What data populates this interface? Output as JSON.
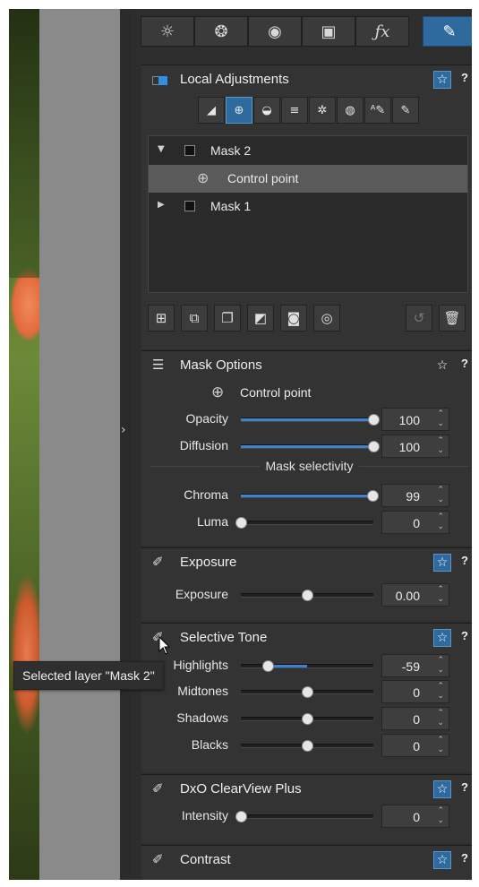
{
  "window": {
    "collapse_glyph": "›"
  },
  "tabs": [
    {
      "icon": "sun-icon",
      "glyph": "☼"
    },
    {
      "icon": "color-circles-icon",
      "glyph": "❂"
    },
    {
      "icon": "lens-icon",
      "glyph": "◉"
    },
    {
      "icon": "geometry-cube-icon",
      "glyph": "▣"
    },
    {
      "icon": "fx-icon",
      "glyph": "ƒx"
    },
    {
      "icon": "local-adjustments-brush-icon",
      "glyph": "✎"
    }
  ],
  "local_adjustments": {
    "title": "Local Adjustments",
    "star": "☆",
    "help": "?",
    "tools": [
      {
        "icon": "manual-mask-icon",
        "glyph": "◢"
      },
      {
        "icon": "control-point-tool-icon",
        "glyph": "⊕"
      },
      {
        "icon": "graduated-filter-icon",
        "glyph": "◒"
      },
      {
        "icon": "brush-lines-icon",
        "glyph": "≡"
      },
      {
        "icon": "auto-mask-icon",
        "glyph": "✲"
      },
      {
        "icon": "eraser-icon",
        "glyph": "◍"
      },
      {
        "icon": "auto-brush-icon",
        "glyph": "ᴬ✎"
      },
      {
        "icon": "brush-icon",
        "glyph": "✎"
      }
    ],
    "masks": [
      {
        "label": "Mask 2",
        "expanded": true,
        "tri": "▼"
      },
      {
        "label": "Control point",
        "child": true
      },
      {
        "label": "Mask 1",
        "expanded": false,
        "tri": "▶"
      }
    ],
    "actions": [
      {
        "icon": "add-mask-icon",
        "glyph": "⊞"
      },
      {
        "icon": "add-layer-icon",
        "glyph": "⧉"
      },
      {
        "icon": "duplicate-icon",
        "glyph": "❐"
      },
      {
        "icon": "invert-icon",
        "glyph": "◩"
      },
      {
        "icon": "show-mask-icon",
        "glyph": "◙"
      },
      {
        "icon": "eye-icon",
        "glyph": "◎"
      },
      {
        "icon": "undo-icon",
        "glyph": "↺"
      },
      {
        "icon": "trash-icon",
        "glyph": "🗑"
      }
    ]
  },
  "mask_options": {
    "title": "Mask Options",
    "icon": "sliders-icon",
    "glyph": "☰",
    "star": "☆",
    "help": "?",
    "control_point_label": "Control point",
    "opacity": {
      "label": "Opacity",
      "value": "100",
      "frac": 1.0
    },
    "diffusion": {
      "label": "Diffusion",
      "value": "100",
      "frac": 1.0
    },
    "selectivity_title": "Mask selectivity",
    "chroma": {
      "label": "Chroma",
      "value": "99",
      "frac": 0.99
    },
    "luma": {
      "label": "Luma",
      "value": "0",
      "frac": 0.0
    }
  },
  "exposure": {
    "title": "Exposure",
    "star": "☆",
    "help": "?",
    "slider": {
      "label": "Exposure",
      "value": "0.00",
      "frac": 0.5
    }
  },
  "selective_tone": {
    "title": "Selective Tone",
    "star": "☆",
    "help": "?",
    "highlights": {
      "label": "Highlights",
      "value": "-59",
      "frac": 0.205
    },
    "midtones": {
      "label": "Midtones",
      "value": "0",
      "frac": 0.5
    },
    "shadows": {
      "label": "Shadows",
      "value": "0",
      "frac": 0.5
    },
    "blacks": {
      "label": "Blacks",
      "value": "0",
      "frac": 0.5
    }
  },
  "clearview": {
    "title": "DxO ClearView Plus",
    "star": "☆",
    "help": "?",
    "intensity": {
      "label": "Intensity",
      "value": "0",
      "frac": 0.0
    }
  },
  "contrast": {
    "title": "Contrast",
    "star": "☆",
    "help": "?"
  },
  "tooltip": "Selected layer \"Mask 2\"",
  "spin_glyph": "⌃⌄",
  "pen_glyph": "✐",
  "cursor_glyph": "➤",
  "colors": {
    "accent": "#2e6a9e",
    "slider_fill": "#3b83cf",
    "panel_bg": "#333333"
  }
}
